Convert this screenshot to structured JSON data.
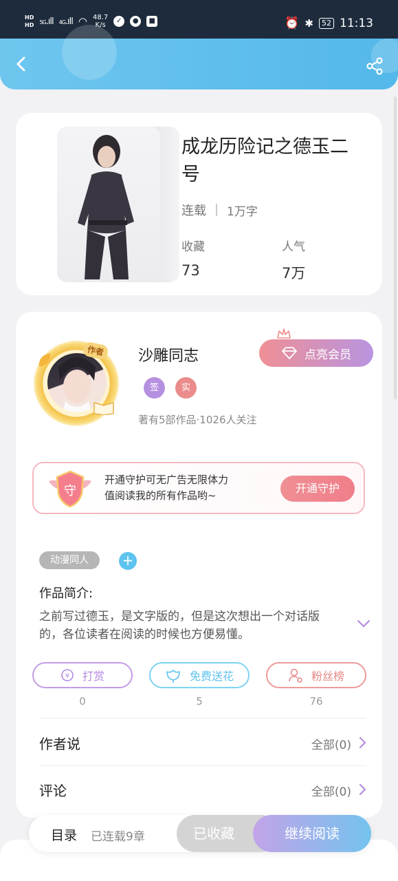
{
  "status_bar": {
    "hd_top": "HD",
    "hd_bottom": "HD",
    "signal1": "5G",
    "signal2": "4G",
    "speed_value": "48.7",
    "speed_unit": "K/s",
    "battery": "52",
    "time": "11:13"
  },
  "book": {
    "title": "成龙历险记之德玉二号",
    "status": "连载",
    "word_count": "1万字",
    "favorites_label": "收藏",
    "favorites_value": "73",
    "popularity_label": "人气",
    "popularity_value": "7万"
  },
  "author": {
    "tag": "作者",
    "name": "沙雕同志",
    "vip_label": "点亮会员",
    "badge_sign": "签",
    "badge_real": "实",
    "stats": "著有5部作品·1026人关注"
  },
  "guard": {
    "emblem_char": "守",
    "line1": "开通守护可无广告无限体力",
    "line2": "值阅读我的所有作品哟~",
    "button": "开通守护"
  },
  "intro": {
    "tag": "动漫同人",
    "add": "+",
    "label": "作品简介:",
    "text": "之前写过德玉，是文字版的，但是这次想出一个对话版的，各位读者在阅读的时候也方便易懂。"
  },
  "actions": [
    {
      "label": "打赏",
      "count": "0"
    },
    {
      "label": "免费送花",
      "count": "5"
    },
    {
      "label": "粉丝榜",
      "count": "76"
    }
  ],
  "rows": {
    "author_says": {
      "title": "作者说",
      "all": "全部(0)"
    },
    "comments": {
      "title": "评论",
      "all": "全部(0)"
    }
  },
  "bottom": {
    "toc": "目录",
    "chapters": "已连载9章",
    "collected": "已收藏",
    "continue": "继续阅读"
  },
  "colors": {
    "header": "#5ec3ee",
    "vip_gradient_start": "#ef8f96",
    "vip_gradient_end": "#b894e0",
    "continue_gradient_start": "#c2a3e8",
    "continue_gradient_end": "#74c3ee"
  }
}
